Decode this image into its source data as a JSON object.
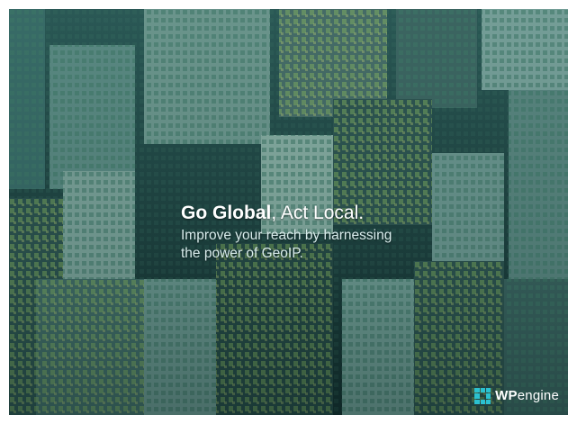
{
  "hero": {
    "headline_bold": "Go Global",
    "headline_rest": ", Act Local.",
    "subtext_line1": "Improve your reach by harnessing",
    "subtext_line2": "the power of GeoIP."
  },
  "brand": {
    "logo_bold": "WP",
    "logo_light": "engine",
    "logo_icon": "wpengine-grid-icon",
    "accent_color": "#2bc1d0"
  },
  "background": {
    "image": "city-skyline-aerial",
    "tint_color": "#1f4a48"
  }
}
